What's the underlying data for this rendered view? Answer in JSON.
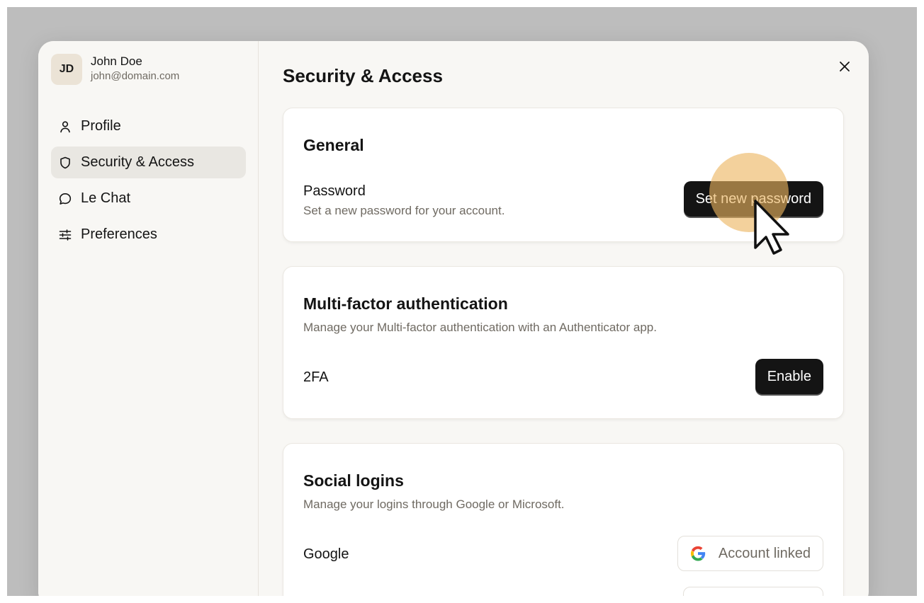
{
  "user": {
    "initials": "JD",
    "name": "John Doe",
    "email": "john@domain.com"
  },
  "nav": [
    {
      "label": "Profile",
      "icon": "user-icon"
    },
    {
      "label": "Security & Access",
      "icon": "shield-icon",
      "active": true
    },
    {
      "label": "Le Chat",
      "icon": "chat-bubble-icon"
    },
    {
      "label": "Preferences",
      "icon": "sliders-icon"
    }
  ],
  "page": {
    "title": "Security & Access"
  },
  "general": {
    "title": "General",
    "password_label": "Password",
    "password_desc": "Set a new password for your account.",
    "password_button": "Set new password"
  },
  "mfa": {
    "title": "Multi-factor authentication",
    "desc": "Manage your Multi-factor authentication with an Authenticator app.",
    "row_label": "2FA",
    "button": "Enable"
  },
  "social": {
    "title": "Social logins",
    "desc": "Manage your logins through Google or Microsoft.",
    "google_label": "Google",
    "google_button": "Account linked"
  },
  "colors": {
    "backdrop": "#bdbdbd",
    "modal_bg": "#f8f7f4",
    "primary_button": "#141414",
    "muted_text": "#6f6a62",
    "click_highlight": "#ebb45f"
  }
}
